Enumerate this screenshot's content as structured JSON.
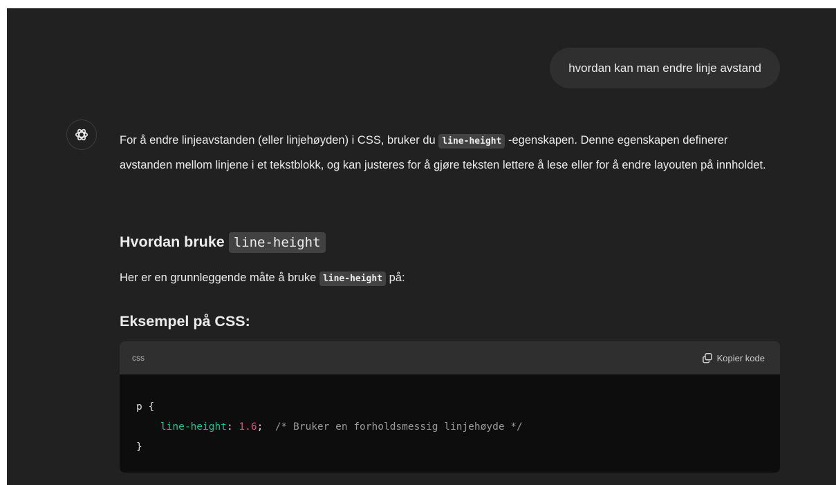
{
  "user_message": "hvordan kan man endre linje avstand",
  "assistant": {
    "intro_pre": "For å endre linjeavstanden (eller linjehøyden) i CSS, bruker du ",
    "intro_code": "line-height",
    "intro_post": " -egenskapen. Denne egenskapen definerer avstanden mellom linjene i et tekstblokk, og kan justeres for å gjøre teksten lettere å lese eller for å endre layouten på innholdet.",
    "heading1_text": "Hvordan bruke ",
    "heading1_code": "line-height",
    "para2_pre": "Her er en grunnleggende måte å bruke ",
    "para2_code": "line-height",
    "para2_post": " på:",
    "heading2": "Eksempel på CSS:"
  },
  "code_block": {
    "language": "css",
    "copy_label": "Kopier kode",
    "selector": "p",
    "open_brace": " {",
    "property": "line-height",
    "colon": ": ",
    "value": "1.6",
    "semicolon": ";",
    "comment": "/* Bruker en forholdsmessig linjehøyde */",
    "close_brace": "}"
  },
  "icons": {
    "avatar": "openai-logo-icon",
    "copy": "copy-icon"
  }
}
